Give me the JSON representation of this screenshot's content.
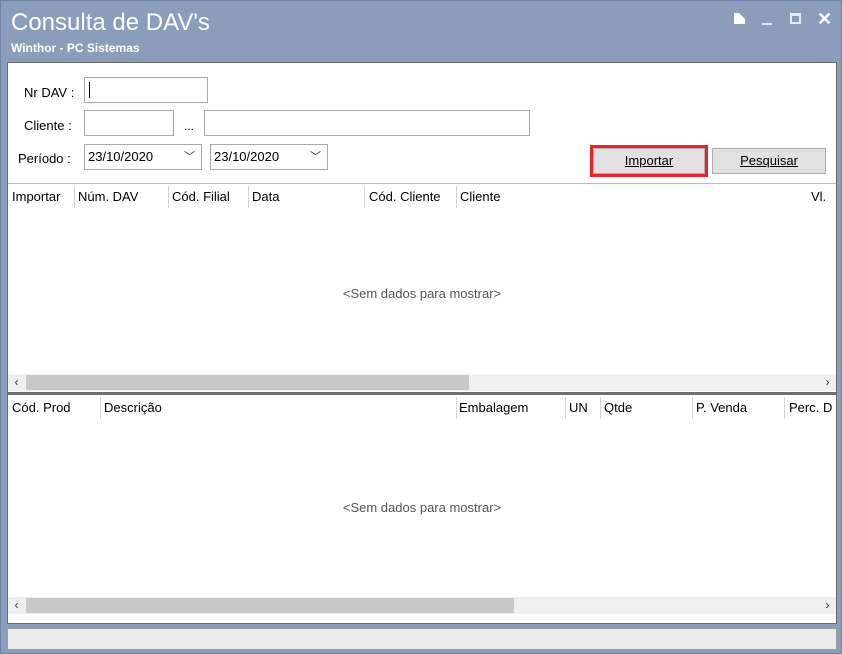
{
  "window": {
    "title": "Consulta de DAV's",
    "subtitle": "Winthor - PC Sistemas",
    "controls": {
      "close_glyph": "✕"
    }
  },
  "form": {
    "nr_dav_label": "Nr DAV :",
    "nr_dav_value": "",
    "cliente_label": "Cliente :",
    "cliente_code_value": "",
    "cliente_dots": "...",
    "cliente_name_value": "",
    "periodo_label": "Período :",
    "date_from": "23/10/2020",
    "date_to": "23/10/2020",
    "importar_button": "Importar",
    "pesquisar_button": "Pesquisar",
    "highlighted_button_color": "#e8232b"
  },
  "dav_grid": {
    "columns": [
      "Importar",
      "Núm. DAV",
      "Cód. Filial",
      "Data",
      "Cód. Cliente",
      "Cliente",
      "Vl."
    ],
    "empty_text": "<Sem dados para mostrar>"
  },
  "items_grid": {
    "columns": [
      "Cód. Prod",
      "Descrição",
      "Embalagem",
      "UN",
      "Qtde",
      "P. Venda",
      "Perc. D"
    ],
    "empty_text": "<Sem dados para mostrar>"
  },
  "icons": {
    "scroll_left": "‹",
    "scroll_right": "›",
    "date_dropdown": "﹀"
  },
  "colors": {
    "titlebar": "#8a9dbb",
    "highlight": "#e8232b"
  },
  "status_text": ""
}
